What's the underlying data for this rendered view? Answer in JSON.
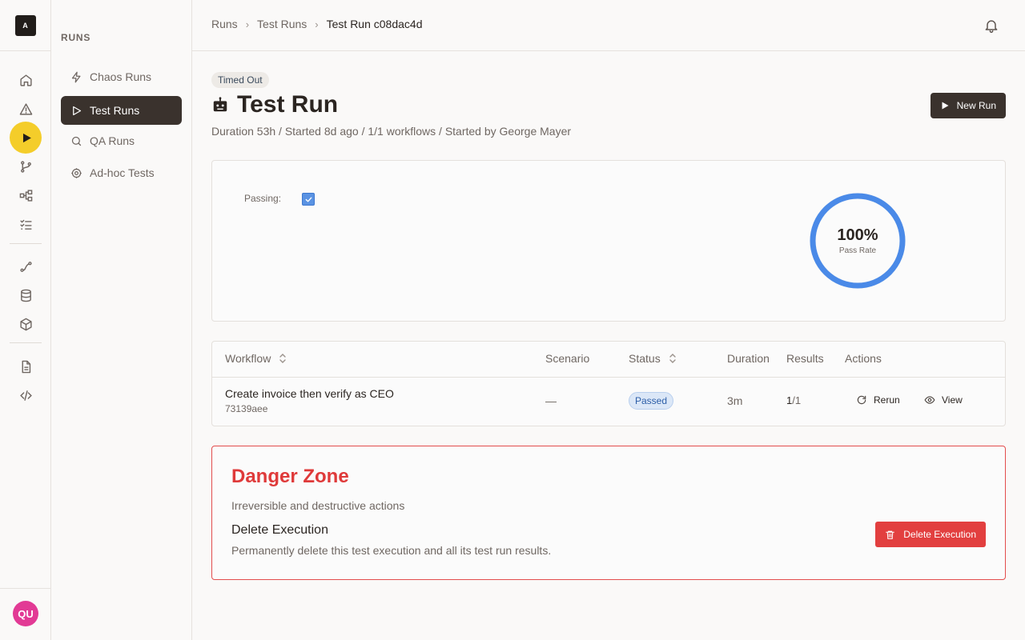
{
  "rail": {
    "logo_text": "A",
    "avatar_initials": "QU",
    "icons": [
      "home-icon",
      "alert-icon",
      "play-icon",
      "branch-icon",
      "hierarchy-icon",
      "checklist-icon",
      "route-icon",
      "database-icon",
      "cube-icon",
      "document-icon",
      "code-icon"
    ]
  },
  "sidebar": {
    "section_title": "RUNS",
    "items": [
      {
        "label": "Chaos Runs",
        "icon": "lightning-icon"
      },
      {
        "label": "Test Runs",
        "icon": "play-outline-icon",
        "active": true
      },
      {
        "label": "QA Runs",
        "icon": "search-icon"
      },
      {
        "label": "Ad-hoc Tests",
        "icon": "target-icon"
      }
    ]
  },
  "breadcrumb": [
    "Runs",
    "Test Runs",
    "Test Run c08dac4d"
  ],
  "header": {
    "badge": "Timed Out",
    "title": "Test Run",
    "meta": "Duration 53h / Started 8d ago / 1/1 workflows / Started by George Mayer",
    "new_run_label": "New Run"
  },
  "summary": {
    "passing_label": "Passing:",
    "passing_checked": true,
    "pass_rate_value": 100,
    "pass_rate_text": "100%",
    "pass_rate_label": "Pass Rate",
    "ring_color": "#4a8ae8"
  },
  "table": {
    "columns": [
      "Workflow",
      "Scenario",
      "Status",
      "Duration",
      "Results",
      "Actions"
    ],
    "rows": [
      {
        "workflow": "Create invoice then verify as CEO",
        "workflow_id": "73139aee",
        "scenario": "—",
        "status": "Passed",
        "duration": "3m",
        "results_num": "1",
        "results_den": "/1",
        "actions": [
          "Rerun",
          "View"
        ]
      }
    ]
  },
  "danger_zone": {
    "title": "Danger Zone",
    "subtitle": "Irreversible and destructive actions",
    "action_title": "Delete Execution",
    "action_desc": "Permanently delete this test execution and all its test run results.",
    "button_label": "Delete Execution",
    "accent": "#e23f3f"
  }
}
